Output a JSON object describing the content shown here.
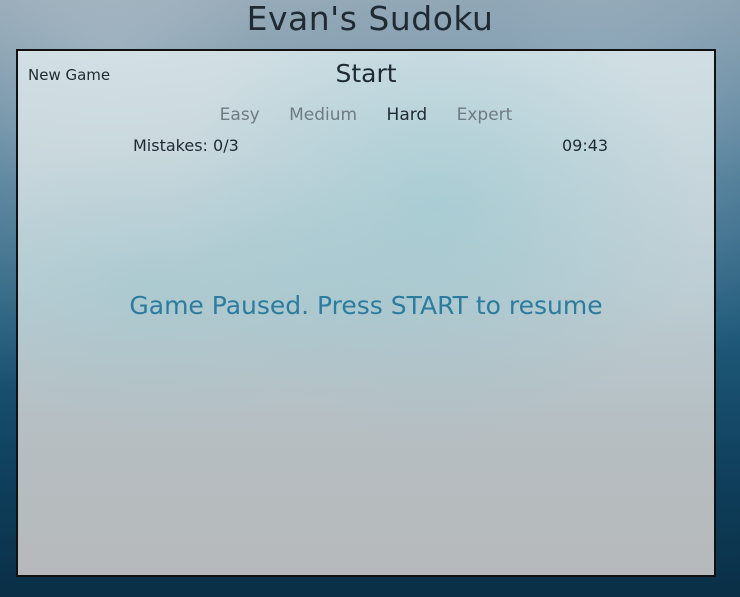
{
  "app": {
    "title": "Evan's Sudoku"
  },
  "controls": {
    "new_game": "New Game",
    "start": "Start"
  },
  "difficulty": {
    "levels": [
      "Easy",
      "Medium",
      "Hard",
      "Expert"
    ],
    "selected": "Hard"
  },
  "status": {
    "mistakes": "Mistakes: 0/3",
    "timer": "09:43"
  },
  "message": {
    "paused": "Game Paused. Press START to resume"
  },
  "colors": {
    "accent": "#2b7c9e",
    "text": "#1f2a33",
    "inactive_level": "#6f7b82"
  }
}
